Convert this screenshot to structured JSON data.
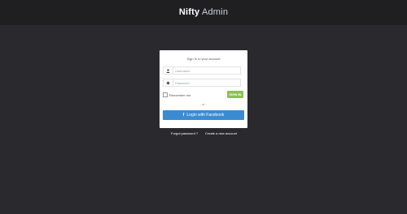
{
  "brand": {
    "title_bold": "Nifty",
    "title_light": "Admin"
  },
  "login": {
    "heading": "Sign In to your account",
    "username_placeholder": "Username",
    "password_placeholder": "Password",
    "remember_label": "Remember me",
    "signin_label": "SIGN IN",
    "or_label": "- or -",
    "facebook_icon_glyph": "f",
    "facebook_label": "Login with Facebook"
  },
  "footer": {
    "forgot_label": "Forgot password ?",
    "create_label": "Create a new account"
  },
  "colors": {
    "background": "#2a2a2e",
    "topbar": "#1f1f22",
    "signin": "#8bc34a",
    "facebook": "#3b8bd2"
  }
}
